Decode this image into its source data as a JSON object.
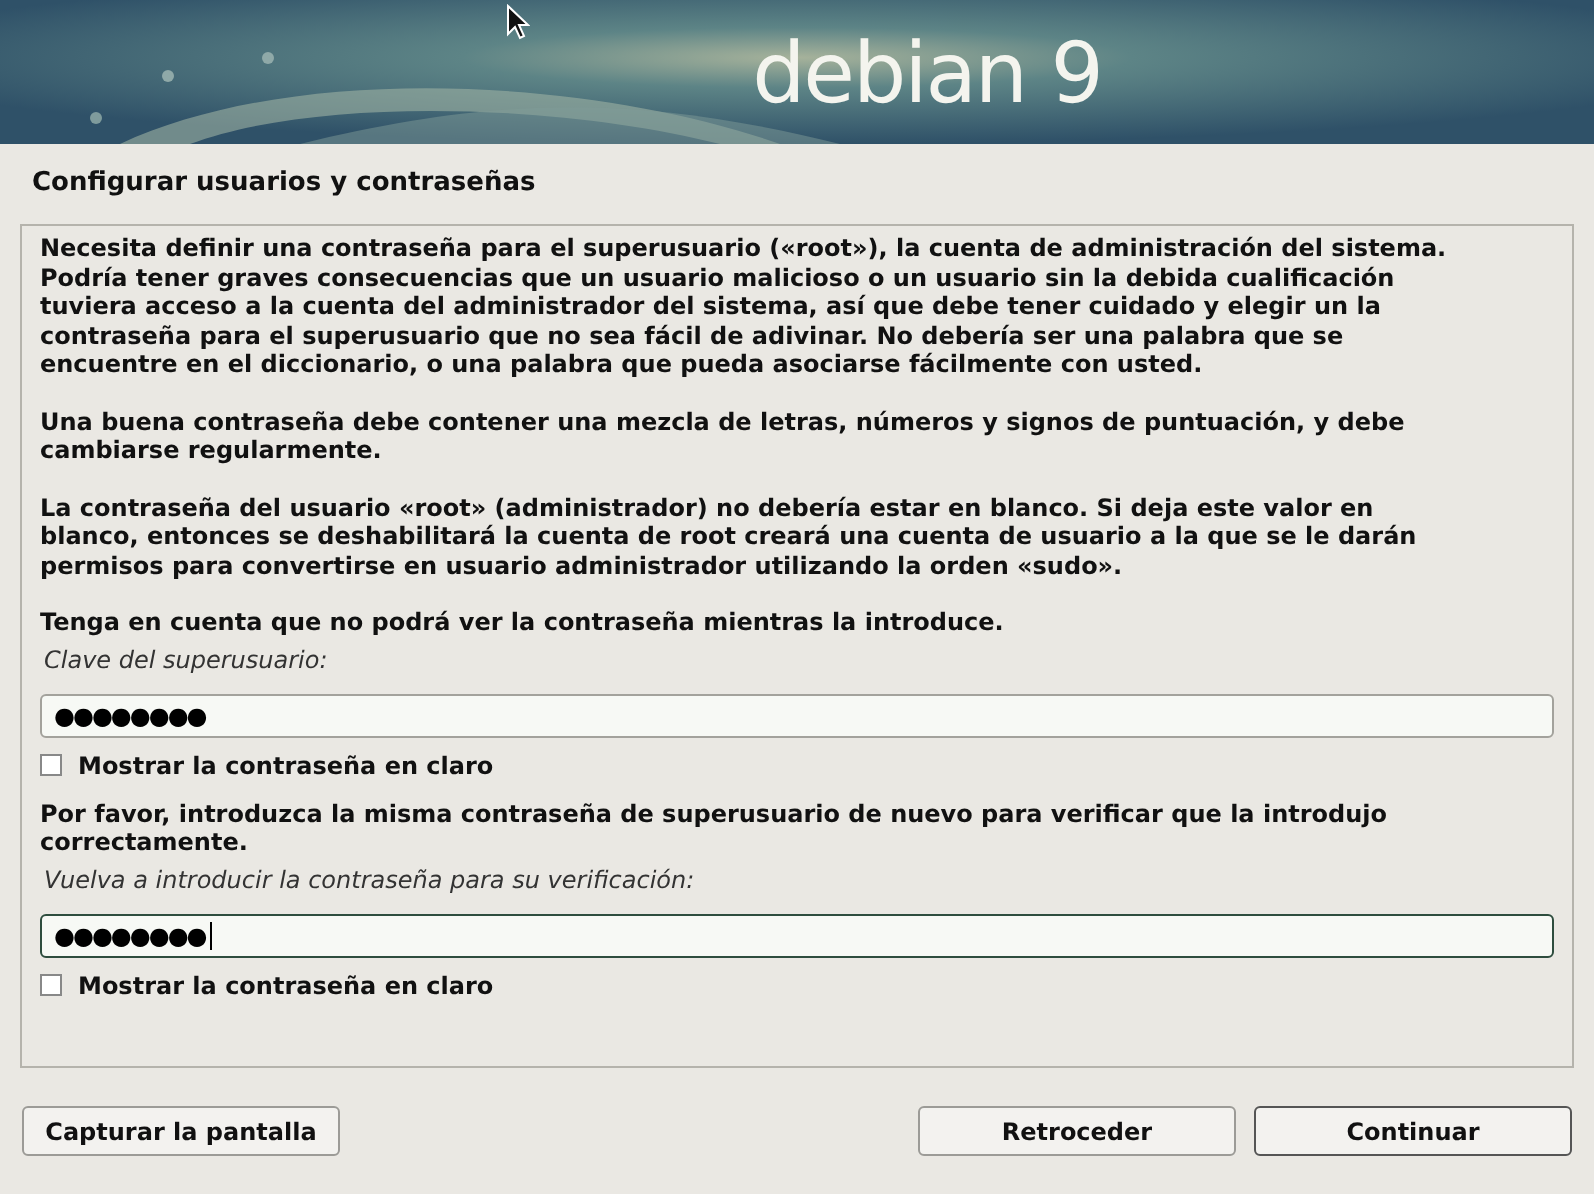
{
  "banner": {
    "logo": "debian 9"
  },
  "title": "Configurar usuarios y contraseñas",
  "paragraphs": [
    [
      "Necesita definir una contraseña para el superusuario («root»), la cuenta de administración del sistema.",
      "Podría tener graves consecuencias que un usuario malicioso o un usuario sin la debida cualificación",
      "tuviera acceso a la cuenta del administrador del sistema, así que debe tener cuidado y elegir un la",
      "contraseña para el superusuario que no sea fácil de adivinar. No debería ser una palabra que se",
      "encuentre en el diccionario, o una palabra que pueda asociarse fácilmente con usted."
    ],
    [
      "Una buena contraseña debe contener una mezcla de letras, números y signos de puntuación, y debe",
      "cambiarse regularmente."
    ],
    [
      "La contraseña del usuario «root» (administrador) no debería estar en blanco. Si deja este valor en",
      "blanco, entonces se deshabilitará la cuenta de root creará una cuenta de usuario a la que se le darán",
      "permisos para convertirse en usuario administrador utilizando la orden «sudo»."
    ],
    [
      "Tenga en cuenta que no podrá ver la contraseña mientras la introduce."
    ]
  ],
  "fields": [
    {
      "label": "Clave del superusuario:",
      "value": "●●●●●●●●",
      "focused": false,
      "show_password": {
        "label": "Mostrar la contraseña en claro",
        "checked": false
      }
    },
    {
      "intro": [
        "Por favor, introduzca la misma contraseña de superusuario de nuevo para verificar que la introdujo",
        "correctamente."
      ],
      "label": "Vuelva a introducir la contraseña para su verificación:",
      "value": "●●●●●●●●",
      "focused": true,
      "show_password": {
        "label": "Mostrar la contraseña en claro",
        "checked": false
      }
    }
  ],
  "buttons": {
    "screenshot": "Capturar la pantalla",
    "back": "Retroceder",
    "continue": "Continuar"
  }
}
